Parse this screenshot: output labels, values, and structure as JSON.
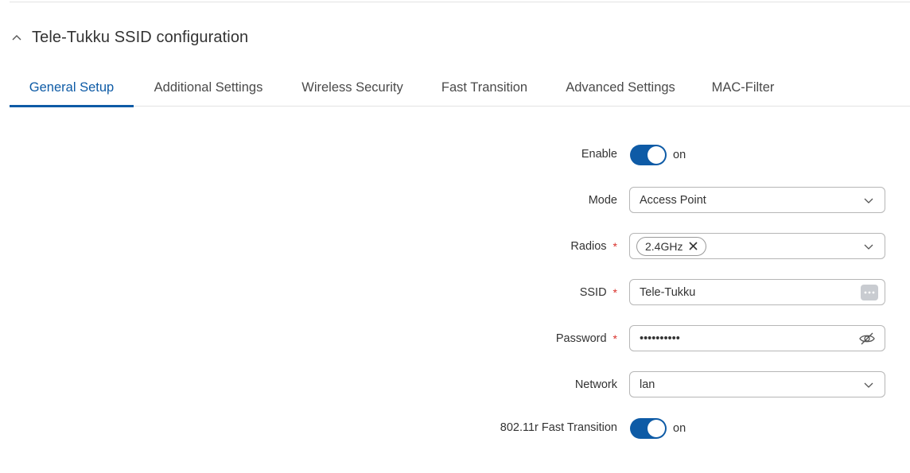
{
  "section": {
    "title": "Tele-Tukku SSID configuration"
  },
  "tabs": [
    {
      "label": "General Setup",
      "active": true
    },
    {
      "label": "Additional Settings"
    },
    {
      "label": "Wireless Security"
    },
    {
      "label": "Fast Transition"
    },
    {
      "label": "Advanced Settings"
    },
    {
      "label": "MAC-Filter"
    }
  ],
  "form": {
    "enable": {
      "label": "Enable",
      "state": "on"
    },
    "mode": {
      "label": "Mode",
      "value": "Access Point"
    },
    "radios": {
      "label": "Radios",
      "required_mark": "*",
      "chip": "2.4GHz"
    },
    "ssid": {
      "label": "SSID",
      "required_mark": "*",
      "value": "Tele-Tukku"
    },
    "password": {
      "label": "Password",
      "required_mark": "*",
      "value": "••••••••••"
    },
    "network": {
      "label": "Network",
      "value": "lan"
    },
    "fast_transition": {
      "label": "802.11r Fast Transition",
      "state": "on"
    }
  },
  "colors": {
    "accent": "#0e5ba6",
    "required": "#d9312b",
    "border": "#b6b6b6"
  },
  "icons": [
    "chevron-up-icon",
    "chevron-down-icon",
    "close-icon",
    "more-dots-icon",
    "eye-slash-icon"
  ]
}
